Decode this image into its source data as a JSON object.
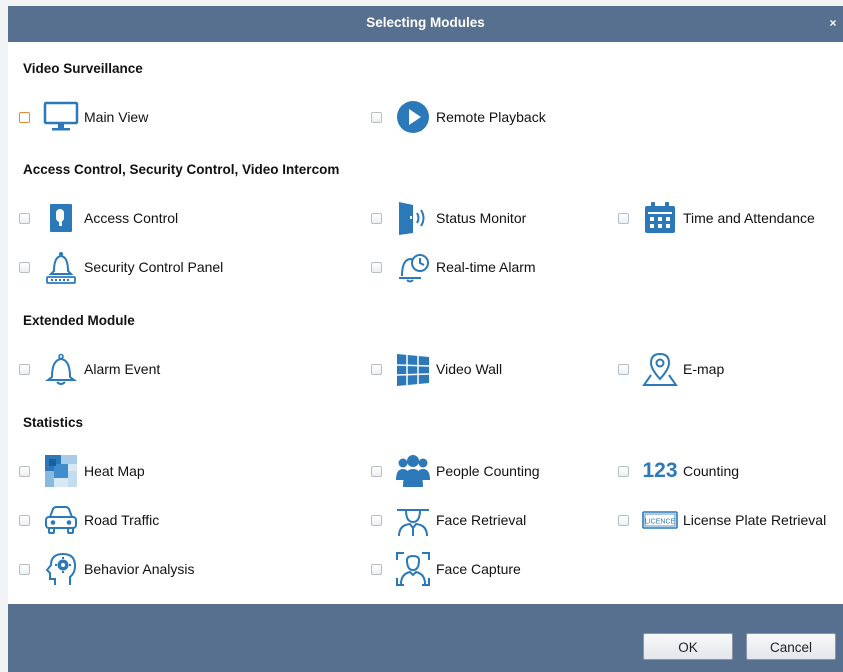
{
  "dialog": {
    "title": "Selecting Modules",
    "close_glyph": "×"
  },
  "sections": [
    {
      "title": "Video Surveillance",
      "items": [
        {
          "label": "Main View",
          "icon": "monitor-icon"
        },
        {
          "label": "Remote Playback",
          "icon": "play-circle-icon"
        }
      ]
    },
    {
      "title": "Access Control, Security Control, Video Intercom",
      "items": [
        {
          "label": "Access Control",
          "icon": "door-badge-icon"
        },
        {
          "label": "Status Monitor",
          "icon": "door-status-icon"
        },
        {
          "label": "Time and Attendance",
          "icon": "calendar-icon"
        },
        {
          "label": "Security Control Panel",
          "icon": "bell-panel-icon"
        },
        {
          "label": "Real-time Alarm",
          "icon": "bell-clock-icon"
        }
      ]
    },
    {
      "title": "Extended Module",
      "items": [
        {
          "label": "Alarm Event",
          "icon": "bell-icon"
        },
        {
          "label": "Video Wall",
          "icon": "video-wall-icon"
        },
        {
          "label": "E-map",
          "icon": "map-pin-icon"
        }
      ]
    },
    {
      "title": "Statistics",
      "items": [
        {
          "label": "Heat Map",
          "icon": "heat-map-icon"
        },
        {
          "label": "People Counting",
          "icon": "people-icon"
        },
        {
          "label": "Counting",
          "icon": "counting-123-icon",
          "icon_text": "123"
        },
        {
          "label": "Road Traffic",
          "icon": "car-icon"
        },
        {
          "label": "Face Retrieval",
          "icon": "face-retrieval-icon"
        },
        {
          "label": "License Plate Retrieval",
          "icon": "license-plate-icon",
          "icon_text": "LICENCE"
        },
        {
          "label": "Behavior Analysis",
          "icon": "head-gear-icon"
        },
        {
          "label": "Face Capture",
          "icon": "face-capture-icon"
        }
      ]
    }
  ],
  "footer": {
    "ok_label": "OK",
    "cancel_label": "Cancel"
  },
  "colors": {
    "titlebar": "#58708f",
    "icon_blue": "#2b79b8",
    "focus_checkbox": "#e08a3a"
  }
}
